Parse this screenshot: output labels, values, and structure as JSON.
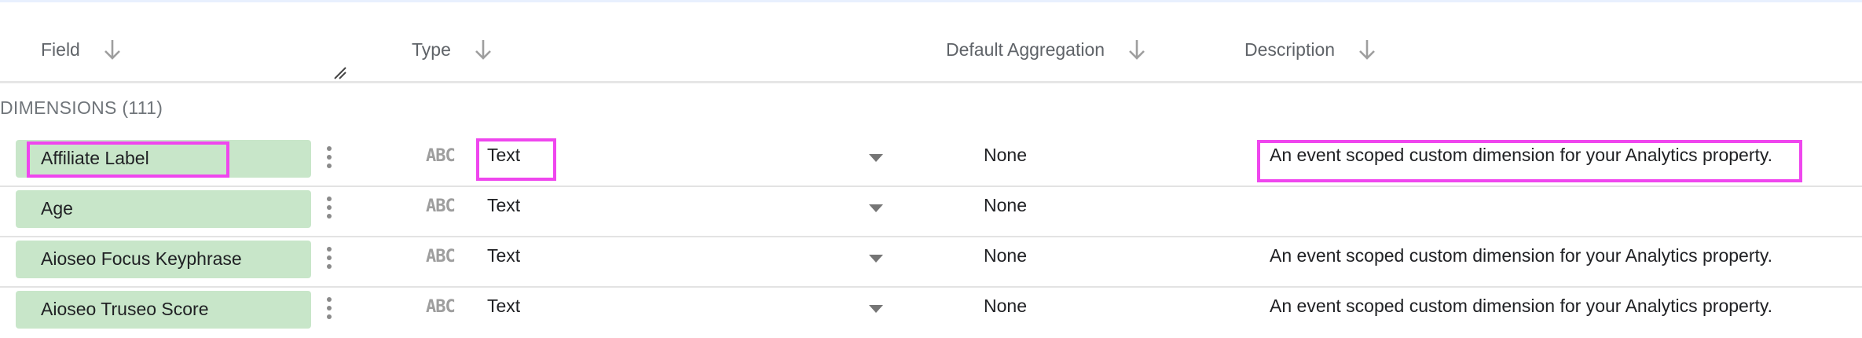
{
  "header": {
    "columns": [
      {
        "label": "Field"
      },
      {
        "label": "Type"
      },
      {
        "label": "Default Aggregation"
      },
      {
        "label": "Description"
      }
    ]
  },
  "section": {
    "label": "DIMENSIONS (111)"
  },
  "rows": [
    {
      "field": "Affiliate Label",
      "type_icon": "ABC",
      "type": "Text",
      "aggregation": "None",
      "description": "An event scoped custom dimension for your Analytics property."
    },
    {
      "field": "Age",
      "type_icon": "ABC",
      "type": "Text",
      "aggregation": "None",
      "description": ""
    },
    {
      "field": "Aioseo Focus Keyphrase",
      "type_icon": "ABC",
      "type": "Text",
      "aggregation": "None",
      "description": "An event scoped custom dimension for your Analytics property."
    },
    {
      "field": "Aioseo Truseo Score",
      "type_icon": "ABC",
      "type": "Text",
      "aggregation": "None",
      "description": "An event scoped custom dimension for your Analytics property."
    }
  ],
  "icons": {
    "sort": "arrow-down-icon",
    "menu": "more-vert-icon",
    "type": "abc-text-type-icon",
    "dropdown": "dropdown-caret-icon",
    "resize": "resize-handle-icon"
  },
  "colors": {
    "chip": "#c8e6c9",
    "highlight": "#ef46ee",
    "header_text": "#5f6368"
  }
}
